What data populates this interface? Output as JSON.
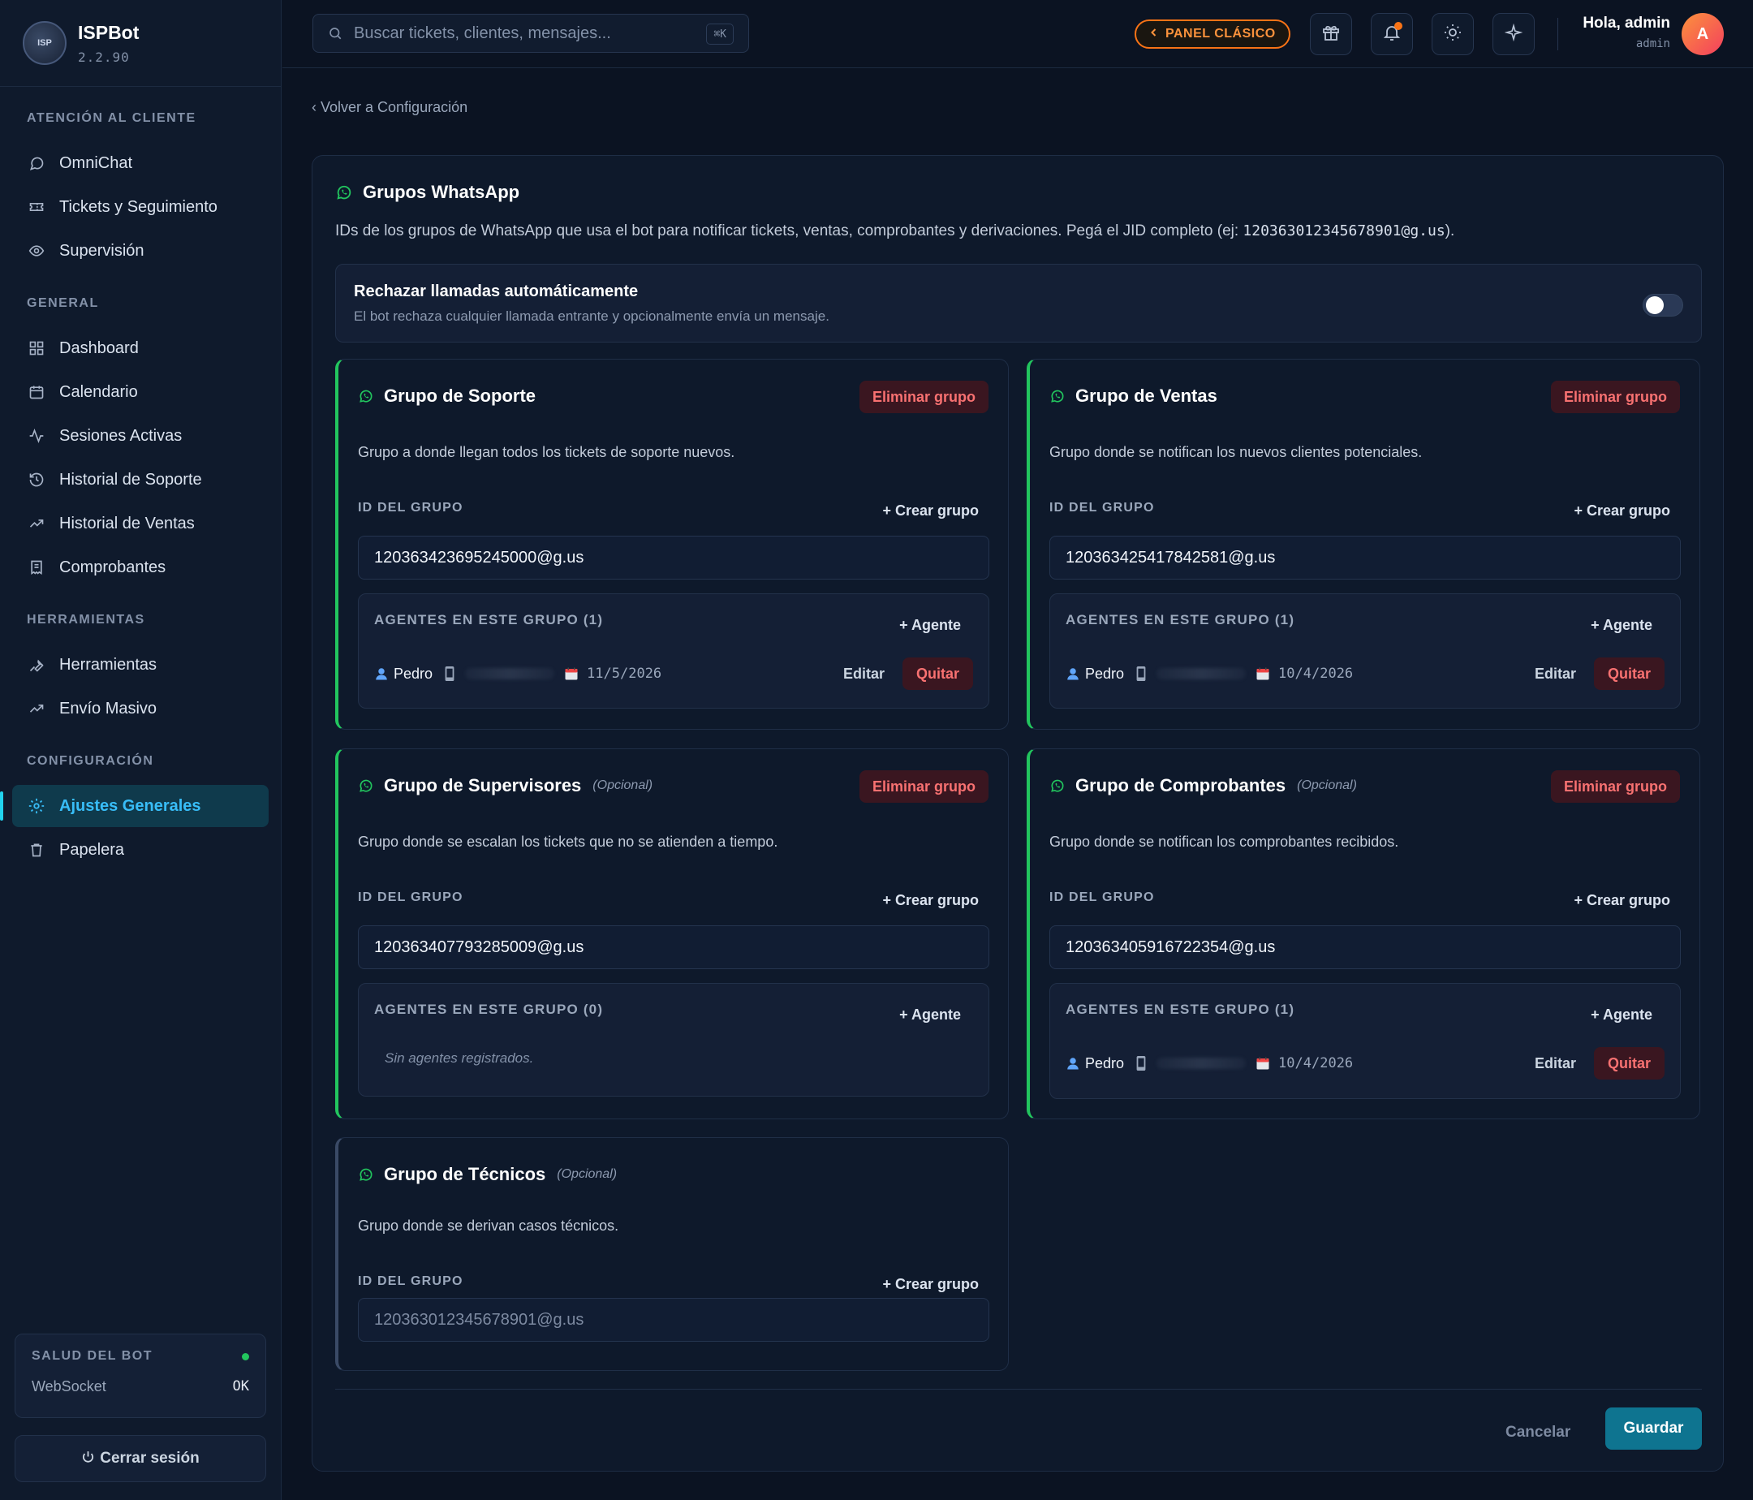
{
  "app": {
    "name": "ISPBot",
    "version": "2.2.90"
  },
  "sidebar": {
    "sections": [
      {
        "title": "ATENCIÓN AL CLIENTE",
        "items": [
          "OmniChat",
          "Tickets y Seguimiento",
          "Supervisión"
        ]
      },
      {
        "title": "GENERAL",
        "items": [
          "Dashboard",
          "Calendario",
          "Sesiones Activas",
          "Historial de Soporte",
          "Historial de Ventas",
          "Comprobantes"
        ]
      },
      {
        "title": "HERRAMIENTAS",
        "items": [
          "Herramientas",
          "Envío Masivo"
        ]
      },
      {
        "title": "CONFIGURACIÓN",
        "items": [
          "Ajustes Generales",
          "Papelera"
        ]
      }
    ],
    "health": {
      "title": "SALUD DEL BOT",
      "label": "WebSocket",
      "value": "OK",
      "status_color": "#22c55e"
    },
    "logout_label": "Cerrar sesión"
  },
  "header": {
    "search_placeholder": "Buscar tickets, clientes, mensajes...",
    "search_shortcut": "⌘K",
    "classic_label": "PANEL CLÁSICO",
    "greeting": "Hola, admin",
    "role": "admin",
    "avatar_initial": "A"
  },
  "main": {
    "back_label": "‹ Volver a Configuración",
    "title": "Grupos WhatsApp",
    "description_prefix": "IDs de los grupos de WhatsApp que usa el bot para notificar tickets, ventas, comprobantes y derivaciones. Pegá el JID completo (ej: ",
    "description_example": "120363012345678901@g.us",
    "description_suffix": ").",
    "reject_calls": {
      "title": "Rechazar llamadas automáticamente",
      "subtitle": "El bot rechaza cualquier llamada entrante y opcionalmente envía un mensaje.",
      "enabled": false
    },
    "labels": {
      "delete_group": "Eliminar grupo",
      "group_id": "ID DEL GRUPO",
      "create_group": "+ Crear grupo",
      "add_agent": "+ Agente",
      "edit": "Editar",
      "remove": "Quitar",
      "no_agents": "Sin agentes registrados."
    },
    "groups": [
      {
        "title": "Grupo de Soporte",
        "optional": "",
        "description": "Grupo a donde llegan todos los tickets de soporte nuevos.",
        "group_id": "120363423695245000@g.us",
        "placeholder": "",
        "agents_header": "AGENTES EN ESTE GRUPO (1)",
        "agent": {
          "name": "Pedro",
          "date": "11/5/2026"
        }
      },
      {
        "title": "Grupo de Ventas",
        "optional": "",
        "description": "Grupo donde se notifican los nuevos clientes potenciales.",
        "group_id": "120363425417842581@g.us",
        "placeholder": "",
        "agents_header": "AGENTES EN ESTE GRUPO (1)",
        "agent": {
          "name": "Pedro",
          "date": "10/4/2026"
        }
      },
      {
        "title": "Grupo de Supervisores",
        "optional": "(Opcional)",
        "description": "Grupo donde se escalan los tickets que no se atienden a tiempo.",
        "group_id": "120363407793285009@g.us",
        "placeholder": "",
        "agents_header": "AGENTES EN ESTE GRUPO (0)",
        "agent": null
      },
      {
        "title": "Grupo de Comprobantes",
        "optional": "(Opcional)",
        "description": "Grupo donde se notifican los comprobantes recibidos.",
        "group_id": "120363405916722354@g.us",
        "placeholder": "",
        "agents_header": "AGENTES EN ESTE GRUPO (1)",
        "agent": {
          "name": "Pedro",
          "date": "10/4/2026"
        }
      },
      {
        "title": "Grupo de Técnicos",
        "optional": "(Opcional)",
        "description": "Grupo donde se derivan casos técnicos.",
        "group_id": "",
        "placeholder": "120363012345678901@g.us",
        "agents_header": "",
        "agent": null
      }
    ],
    "footer": {
      "cancel_label": "Cancelar",
      "save_label": "Guardar"
    }
  },
  "colors": {
    "accent": "#22d3ee",
    "whatsapp": "#22c55e",
    "danger": "#f87171",
    "primary_button": "#0e7490",
    "classic_panel": "#f97316"
  }
}
